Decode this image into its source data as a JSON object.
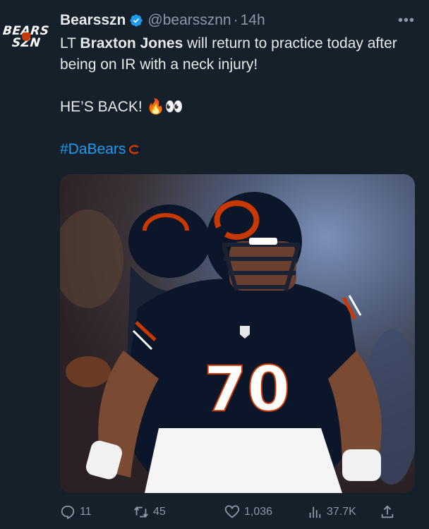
{
  "avatar": {
    "line1": "BEARS",
    "line2": "SZN"
  },
  "author": {
    "display_name": "Bearsszn",
    "handle": "@bearssznn",
    "separator": "·",
    "time": "14h"
  },
  "more_label": "•••",
  "tweet": {
    "line1_prefix": "LT ",
    "line1_bold": "Braxton Jones",
    "line1_suffix": " will return to practice today after being on IR with a neck injury!",
    "line2_text": "HE’S BACK! ",
    "line2_emoji": "🔥👀",
    "hashtag": "#DaBears"
  },
  "photo": {
    "jersey_number": "70",
    "alt": "Bears offensive lineman number 70 in a three-point stance"
  },
  "actions": {
    "replies": "11",
    "retweets": "45",
    "likes": "1,036",
    "views": "37.7K"
  },
  "colors": {
    "background": "#15202b",
    "text": "#e7e9ea",
    "muted": "#8b98a5",
    "link": "#1d9bf0",
    "bears_navy": "#0b162a",
    "bears_orange": "#c83803"
  }
}
